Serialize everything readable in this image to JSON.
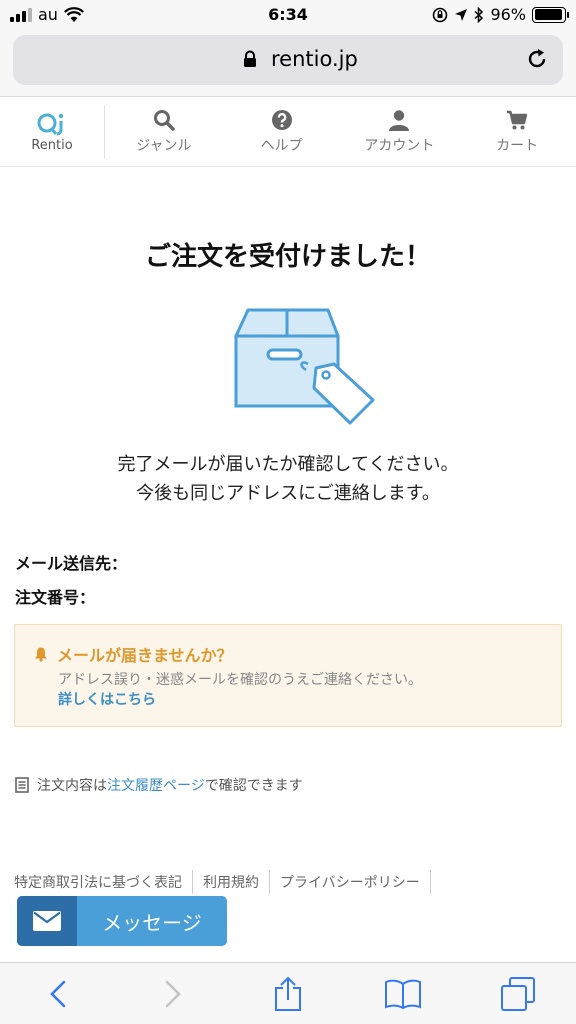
{
  "status_bar": {
    "carrier": "au",
    "time": "6:34",
    "battery": "96%",
    "battery_level": 0.96
  },
  "browser": {
    "url": "rentio.jp"
  },
  "site_nav": {
    "logo_text": "Rentio",
    "items": [
      {
        "label": "ジャンル",
        "icon": "search-icon"
      },
      {
        "label": "ヘルプ",
        "icon": "help-icon"
      },
      {
        "label": "アカウント",
        "icon": "user-icon"
      },
      {
        "label": "カート",
        "icon": "cart-icon"
      }
    ]
  },
  "main": {
    "title": "ご注文を受付けました！",
    "message_line1": "完了メールが届いたか確認してください。",
    "message_line2": "今後も同じアドレスにご連絡します。",
    "mail_to_label": "メール送信先：",
    "order_number_label": "注文番号："
  },
  "notice": {
    "heading": "メールが届きませんか？",
    "body": "アドレス誤り・迷惑メールを確認のうえご連絡ください。",
    "link": "詳しくはこちら"
  },
  "history": {
    "prefix": "注文内容は",
    "link": "注文履歴ページ",
    "suffix": "で確認できます"
  },
  "footer": {
    "links": [
      "特定商取引法に基づく表記",
      "利用規約",
      "プライバシーポリシー"
    ]
  },
  "message_button": {
    "label": "メッセージ"
  },
  "colors": {
    "accent": "#4a9fd8",
    "warning": "#e0972b",
    "link": "#3d8fc6"
  }
}
